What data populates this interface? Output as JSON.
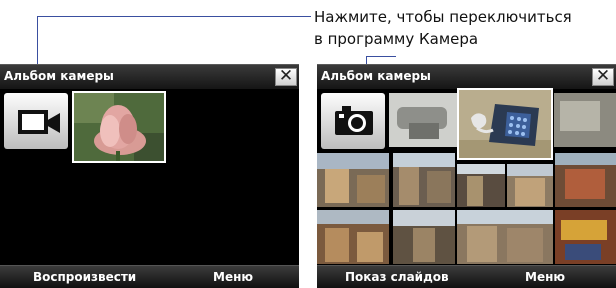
{
  "callout": {
    "line1": "Нажмите, чтобы переключиться",
    "line2": "в программу Камера"
  },
  "left_screen": {
    "title": "Альбом камеры",
    "close_label": "✕",
    "mode_icon": "video-camera-icon",
    "softkey_left": "Воспроизвести",
    "softkey_right": "Меню"
  },
  "right_screen": {
    "title": "Альбом камеры",
    "close_label": "✕",
    "mode_icon": "camera-icon",
    "softkey_left": "Показ слайдов",
    "softkey_right": "Меню"
  },
  "colors": {
    "leader_line": "#3a4fa0",
    "selection_border": "#ffffff"
  }
}
